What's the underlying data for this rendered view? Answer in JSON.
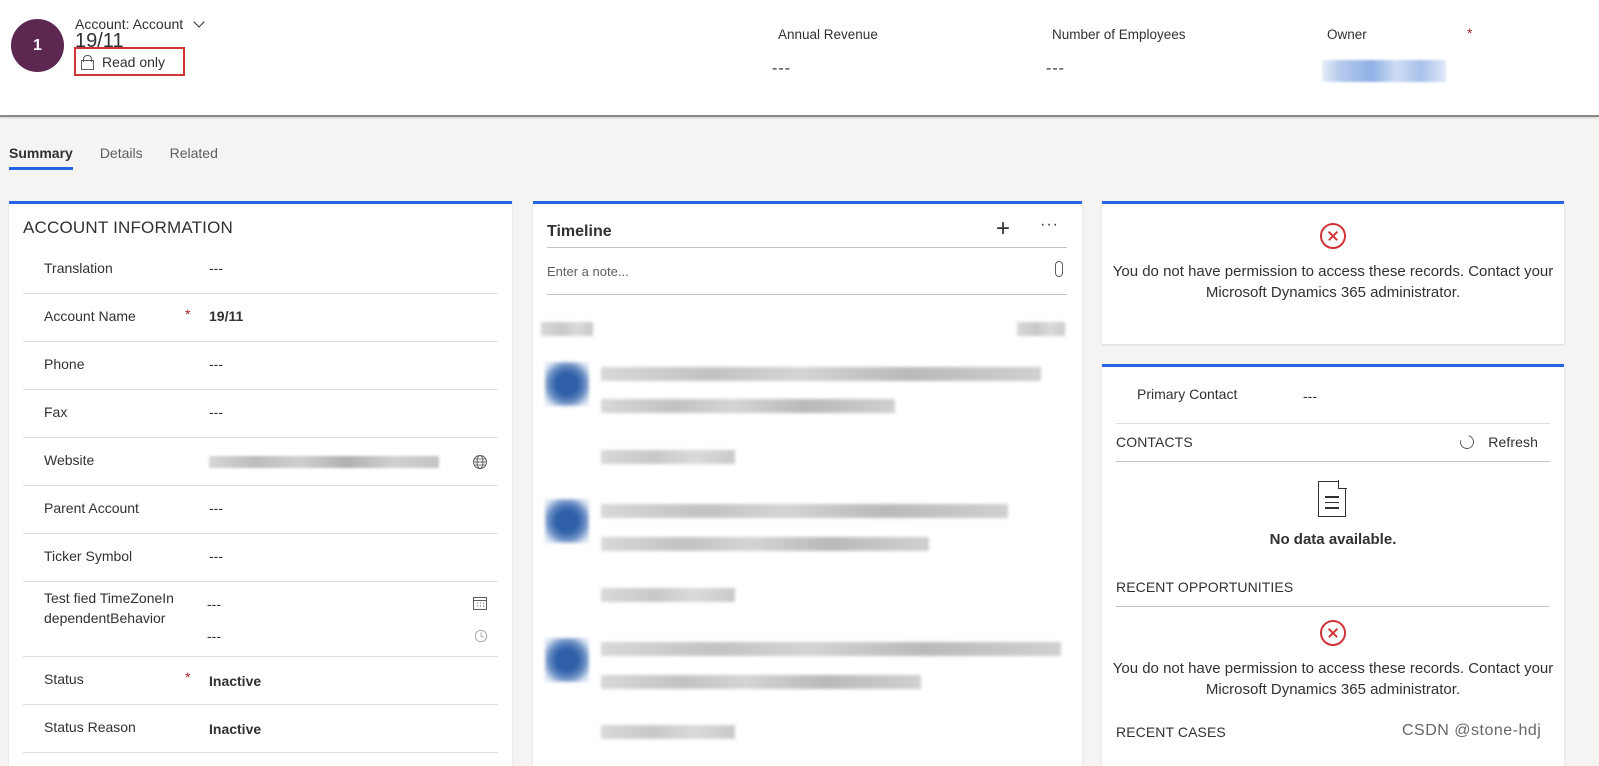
{
  "header": {
    "avatar_initial": "1",
    "entity_label": "Account: Account",
    "record_name": "19/11",
    "read_only_label": "Read only",
    "fields": [
      {
        "label": "Annual Revenue",
        "value": "---"
      },
      {
        "label": "Number of Employees",
        "value": "---"
      },
      {
        "label": "Owner",
        "required": "*"
      }
    ]
  },
  "tabs": [
    "Summary",
    "Details",
    "Related"
  ],
  "account_info": {
    "title": "ACCOUNT INFORMATION",
    "rows": [
      {
        "label": "Translation",
        "value": "---"
      },
      {
        "label": "Account Name",
        "required": "*",
        "value": "19/11"
      },
      {
        "label": "Phone",
        "value": "---"
      },
      {
        "label": "Fax",
        "value": "---"
      },
      {
        "label": "Website"
      },
      {
        "label": "Parent Account",
        "value": "---"
      },
      {
        "label": "Ticker Symbol",
        "value": "---"
      },
      {
        "label": "Test fied TimeZoneIndependentBehavior",
        "value_date": "---",
        "value_time": "---"
      },
      {
        "label": "Status",
        "required": "*",
        "value": "Inactive"
      },
      {
        "label": "Status Reason",
        "value": "Inactive"
      }
    ]
  },
  "timeline": {
    "title": "Timeline",
    "add_icon": "plus-icon",
    "more_label": "···",
    "note_placeholder": "Enter a note..."
  },
  "permission_card": {
    "message": "You do not have permission to access these records. Contact your Microsoft Dynamics 365 administrator."
  },
  "related_card": {
    "primary_contact_label": "Primary Contact",
    "primary_contact_value": "---",
    "contacts_heading": "CONTACTS",
    "refresh_label": "Refresh",
    "no_data": "No data available.",
    "opportunities_heading": "RECENT OPPORTUNITIES",
    "opportunities_message": "You do not have permission to access these records. Contact your Microsoft Dynamics 365 administrator.",
    "cases_heading": "RECENT CASES"
  },
  "watermark": "CSDN @stone-hdj",
  "colors": {
    "accent": "#2266e3",
    "avatar": "#5c2751",
    "error": "#d13438",
    "required": "#a4262c"
  }
}
